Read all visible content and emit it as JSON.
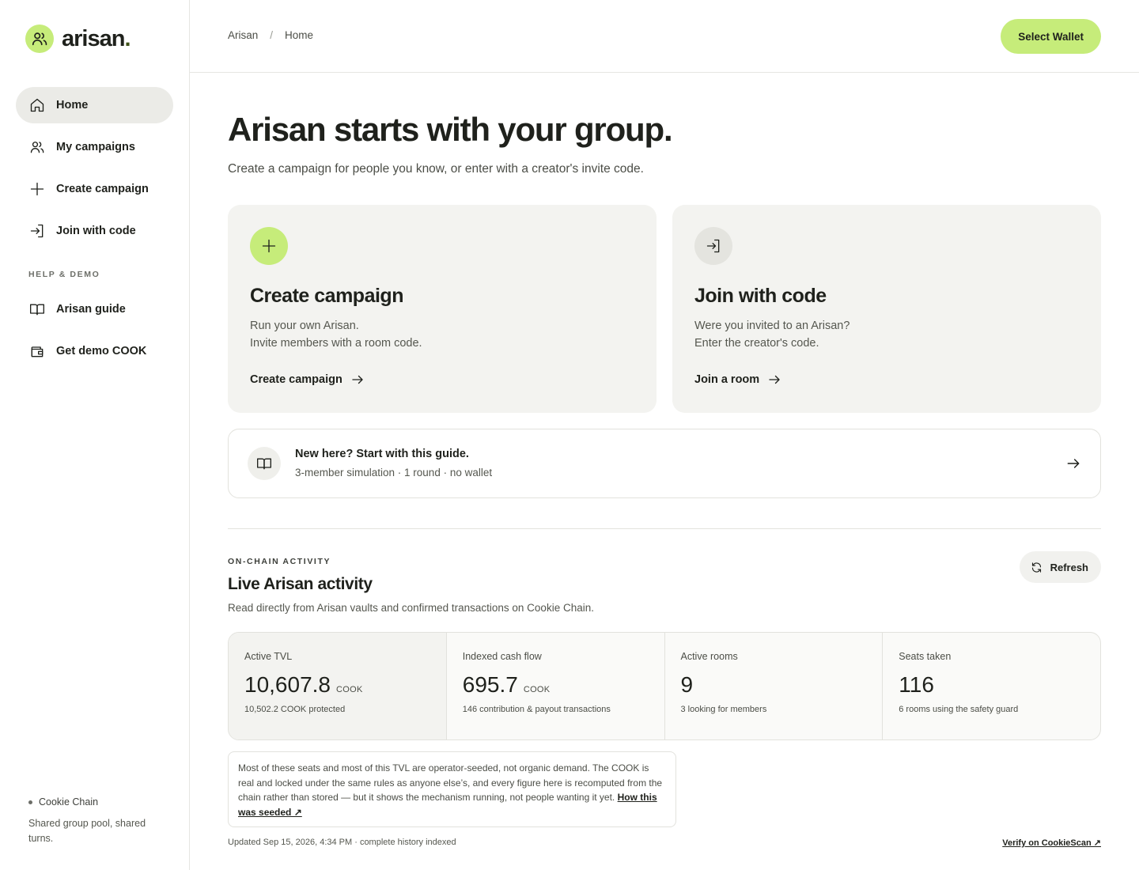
{
  "app": {
    "logo_text": "arisan",
    "logo_dot": "."
  },
  "sidebar": {
    "items": [
      {
        "label": "Home",
        "icon": "home-icon",
        "active": true
      },
      {
        "label": "My campaigns",
        "icon": "users-icon"
      },
      {
        "label": "Create campaign",
        "icon": "plus-icon"
      },
      {
        "label": "Join with code",
        "icon": "login-icon"
      }
    ],
    "section_label": "HELP & DEMO",
    "help_items": [
      {
        "label": "Arisan guide",
        "icon": "book-icon"
      },
      {
        "label": "Get demo COOK",
        "icon": "wallet-icon"
      }
    ],
    "footer": {
      "chain_name": "Cookie Chain",
      "description": "Shared group pool, shared turns."
    }
  },
  "header": {
    "breadcrumb": [
      "Arisan",
      "Home"
    ],
    "breadcrumb_sep": "/",
    "wallet_button": "Select Wallet"
  },
  "hero": {
    "title": "Arisan starts with your group.",
    "subtitle": "Create a campaign for people you know, or enter with a creator's invite code."
  },
  "cards": [
    {
      "title": "Create campaign",
      "desc_line1": "Run your own Arisan.",
      "desc_line2": "Invite members with a room code.",
      "link": "Create campaign",
      "icon": "plus-icon"
    },
    {
      "title": "Join with code",
      "desc_line1": "Were you invited to an Arisan?",
      "desc_line2": "Enter the creator's code.",
      "link": "Join a room",
      "icon": "login-icon"
    }
  ],
  "guide": {
    "title": "New here? Start with this guide.",
    "subtitle": "3-member simulation · 1 round · no wallet",
    "icon": "book-icon"
  },
  "activity": {
    "eyebrow": "ON-CHAIN ACTIVITY",
    "title": "Live Arisan activity",
    "subtitle": "Read directly from Arisan vaults and confirmed transactions on Cookie Chain.",
    "refresh_label": "Refresh",
    "stats": [
      {
        "label": "Active TVL",
        "value": "10,607.8",
        "unit": "COOK",
        "note": "10,502.2 COOK protected"
      },
      {
        "label": "Indexed cash flow",
        "value": "695.7",
        "unit": "COOK",
        "note": "146 contribution & payout transactions"
      },
      {
        "label": "Active rooms",
        "value": "9",
        "unit": "",
        "note": "3 looking for members"
      },
      {
        "label": "Seats taken",
        "value": "116",
        "unit": "",
        "note": "6 rooms using the safety guard"
      }
    ],
    "disclaimer": "Most of these seats and most of this TVL are operator-seeded, not organic demand. The COOK is real and locked under the same rules as anyone else’s, and every figure here is recomputed from the chain rather than stored — but it shows the mechanism running, not people wanting it yet.",
    "disclaimer_link": "How this was seeded ↗",
    "updated": "Updated Sep 15, 2026, 4:34 PM · complete history indexed",
    "verify_link": "Verify on CookieScan ↗"
  },
  "colors": {
    "accent": "#c6ec7a",
    "text": "#1f211c",
    "card_bg": "#f3f3f0"
  }
}
